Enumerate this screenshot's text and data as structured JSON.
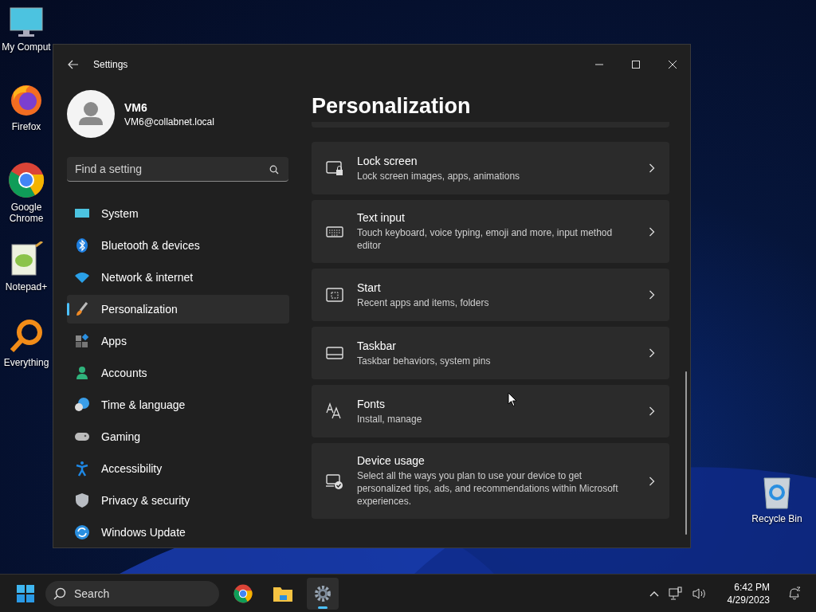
{
  "desktop_icons": [
    {
      "label": "My Comput"
    },
    {
      "label": "Firefox"
    },
    {
      "label": "Google Chrome"
    },
    {
      "label": "Notepad+"
    },
    {
      "label": "Everything"
    },
    {
      "label": "Recycle Bin"
    }
  ],
  "window": {
    "title": "Settings"
  },
  "profile": {
    "name": "VM6",
    "email": "VM6@collabnet.local"
  },
  "search": {
    "placeholder": "Find a setting"
  },
  "sidebar": {
    "items": [
      {
        "label": "System",
        "selected": false
      },
      {
        "label": "Bluetooth & devices",
        "selected": false
      },
      {
        "label": "Network & internet",
        "selected": false
      },
      {
        "label": "Personalization",
        "selected": true
      },
      {
        "label": "Apps",
        "selected": false
      },
      {
        "label": "Accounts",
        "selected": false
      },
      {
        "label": "Time & language",
        "selected": false
      },
      {
        "label": "Gaming",
        "selected": false
      },
      {
        "label": "Accessibility",
        "selected": false
      },
      {
        "label": "Privacy & security",
        "selected": false
      },
      {
        "label": "Windows Update",
        "selected": false
      }
    ]
  },
  "page": {
    "title": "Personalization"
  },
  "cards": [
    {
      "kind": "lock",
      "title": "Lock screen",
      "description": "Lock screen images, apps, animations"
    },
    {
      "kind": "keyboard",
      "title": "Text input",
      "description": "Touch keyboard, voice typing, emoji and more, input method editor"
    },
    {
      "kind": "start",
      "title": "Start",
      "description": "Recent apps and items, folders"
    },
    {
      "kind": "taskbar",
      "title": "Taskbar",
      "description": "Taskbar behaviors, system pins"
    },
    {
      "kind": "fonts",
      "title": "Fonts",
      "description": "Install, manage"
    },
    {
      "kind": "device",
      "title": "Device usage",
      "description": "Select all the ways you plan to use your device to get personalized tips, ads, and recommendations within Microsoft experiences."
    }
  ],
  "taskbar": {
    "search_placeholder": "Search",
    "apps": [
      {
        "kind": "chrome",
        "selected": false
      },
      {
        "kind": "explorer",
        "selected": false
      },
      {
        "kind": "settings",
        "selected": true
      }
    ],
    "time": "6:42 PM",
    "date": "4/29/2023"
  }
}
